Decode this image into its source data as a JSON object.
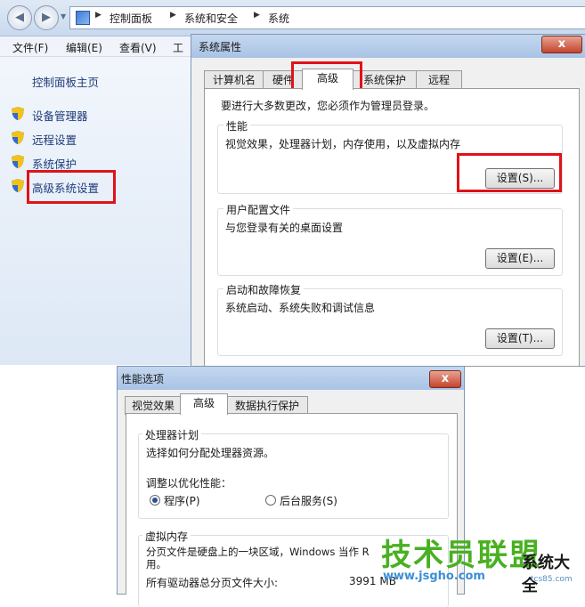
{
  "explorer": {
    "breadcrumb": [
      "控制面板",
      "系统和安全",
      "系统"
    ],
    "menu": [
      "文件(F)",
      "编辑(E)",
      "查看(V)",
      "工"
    ],
    "left_pane": {
      "home": "控制面板主页",
      "items": [
        "设备管理器",
        "远程设置",
        "系统保护",
        "高级系统设置"
      ]
    }
  },
  "system_properties": {
    "title": "系统属性",
    "close": "x",
    "tabs": [
      "计算机名",
      "硬件",
      "高级",
      "系统保护",
      "远程"
    ],
    "admin_note": "要进行大多数更改，您必须作为管理员登录。",
    "performance": {
      "label": "性能",
      "desc": "视觉效果，处理器计划，内存使用，以及虚拟内存",
      "button": "设置(S)..."
    },
    "user_profiles": {
      "label": "用户配置文件",
      "desc": "与您登录有关的桌面设置",
      "button": "设置(E)..."
    },
    "startup": {
      "label": "启动和故障恢复",
      "desc": "系统启动、系统失败和调试信息",
      "button": "设置(T)..."
    }
  },
  "performance_options": {
    "title": "性能选项",
    "close": "x",
    "tabs": [
      "视觉效果",
      "高级",
      "数据执行保护"
    ],
    "processor": {
      "label": "处理器计划",
      "desc": "选择如何分配处理器资源。",
      "adjust": "调整以优化性能：",
      "option_programs": "程序(P)",
      "option_services": "后台服务(S)"
    },
    "virtual_memory": {
      "label": "虚拟内存",
      "desc_line1": "分页文件是硬盘上的一块区域，Windows 当作 R",
      "desc_line2": "用。",
      "total_label": "所有驱动器总分页文件大小:",
      "total_value": "3991 MB"
    }
  },
  "watermark": {
    "brand": "技术员联盟",
    "url": "www.jsgho.com",
    "side": "系统大全",
    "side_small": "tcs85.com"
  },
  "colors": {
    "highlight_red": "#e0121a",
    "link_blue": "#1e3c78",
    "watermark_green": "#49b021"
  }
}
